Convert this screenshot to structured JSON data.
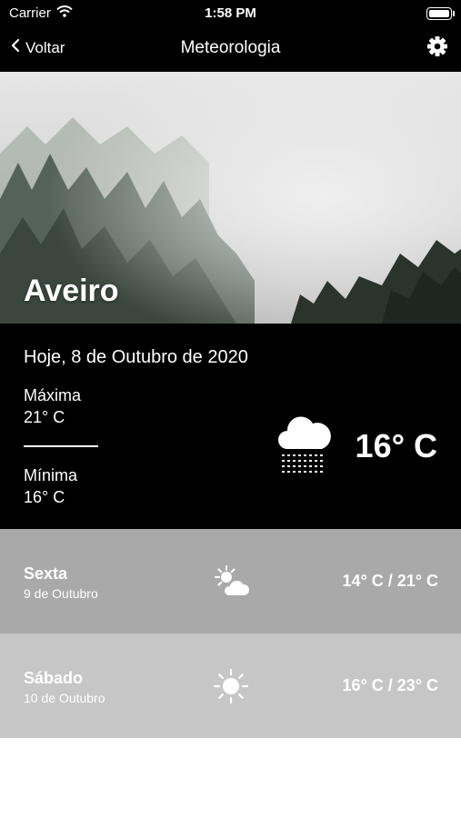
{
  "status_bar": {
    "carrier": "Carrier",
    "time": "1:58 PM"
  },
  "nav": {
    "back_label": "Voltar",
    "title": "Meteorologia"
  },
  "hero": {
    "city": "Aveiro"
  },
  "today": {
    "date": "Hoje, 8 de Outubro de 2020",
    "max_label": "Máxima",
    "max_value": "21° C",
    "min_label": "Mínima",
    "min_value": "16° C",
    "current_temp": "16° C",
    "icon": "cloud-rain-icon"
  },
  "forecast": [
    {
      "day": "Sexta",
      "date": "9 de Outubro",
      "temps": "14° C / 21° C",
      "icon": "partly-cloudy-icon"
    },
    {
      "day": "Sábado",
      "date": "10 de Outubro",
      "temps": "16° C / 23° C",
      "icon": "sun-icon"
    }
  ],
  "colors": {
    "background": "#000000",
    "row1": "#a9a9a9",
    "row2": "#c6c6c6",
    "text": "#ffffff"
  }
}
